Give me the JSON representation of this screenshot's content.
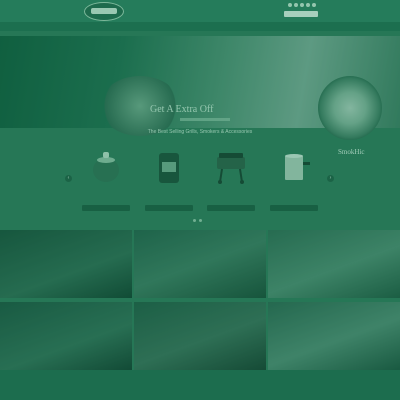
{
  "header": {
    "top_links": "",
    "nav_items": [
      "",
      "",
      "",
      "",
      "",
      "",
      ""
    ]
  },
  "hero": {
    "title": "Get A Extra Off",
    "brand": "SmokHic"
  },
  "products": {
    "title": "The Best Selling Grills, Smokers & Accessories",
    "subtitle": "",
    "prev_arrow": "‹",
    "next_arrow": "›",
    "items": [
      {
        "name": "",
        "price": "",
        "button": "",
        "icon": "kettle-icon"
      },
      {
        "name": "",
        "price": "",
        "button": "",
        "icon": "charcoal-bag-icon"
      },
      {
        "name": "",
        "price": "",
        "button": "",
        "icon": "grill-icon"
      },
      {
        "name": "",
        "price": "",
        "button": "",
        "icon": "chimney-starter-icon"
      }
    ]
  },
  "gallery": {
    "tiles": [
      {
        "label": ""
      },
      {
        "label": ""
      },
      {
        "label": ""
      },
      {
        "label": ""
      },
      {
        "label": ""
      },
      {
        "label": ""
      }
    ]
  },
  "footer": {
    "line1": "",
    "line2": "",
    "line3": ""
  }
}
